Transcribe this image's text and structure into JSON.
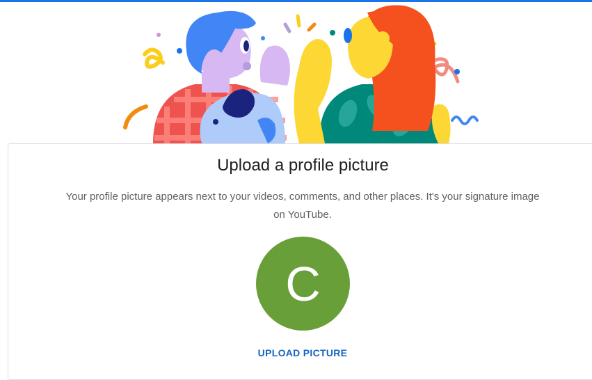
{
  "header": {
    "accent_color": "#1a73e8"
  },
  "illustration": {
    "description_icon": "friends-whispering-illustration"
  },
  "card": {
    "title": "Upload a profile picture",
    "description": "Your profile picture appears next to your videos, comments, and other places. It's your signature image on YouTube.",
    "avatar_letter": "C",
    "avatar_color": "#689f38",
    "upload_label": "UPLOAD PICTURE",
    "link_color": "#1565c0"
  }
}
